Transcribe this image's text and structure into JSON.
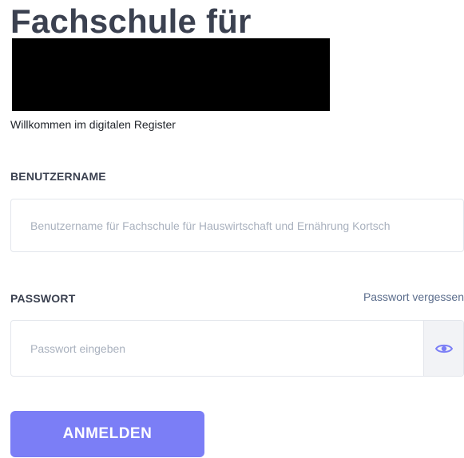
{
  "header": {
    "title": "Fachschule für",
    "subtitle": "Willkommen im digitalen Register"
  },
  "form": {
    "username_label": "BENUTZERNAME",
    "username_placeholder": "Benutzername für Fachschule für Hauswirtschaft und Ernährung Kortsch",
    "username_value": "",
    "password_label": "PASSWORT",
    "password_placeholder": "Passwort eingeben",
    "password_value": "",
    "forgot_password_link": "Passwort vergessen",
    "toggle_visibility_icon": "eye-icon",
    "submit_label": "ANMELDEN"
  },
  "colors": {
    "accent": "#7b7ef6",
    "text": "#3b4150",
    "link": "#5b6d8c",
    "redaction": "#000000"
  }
}
